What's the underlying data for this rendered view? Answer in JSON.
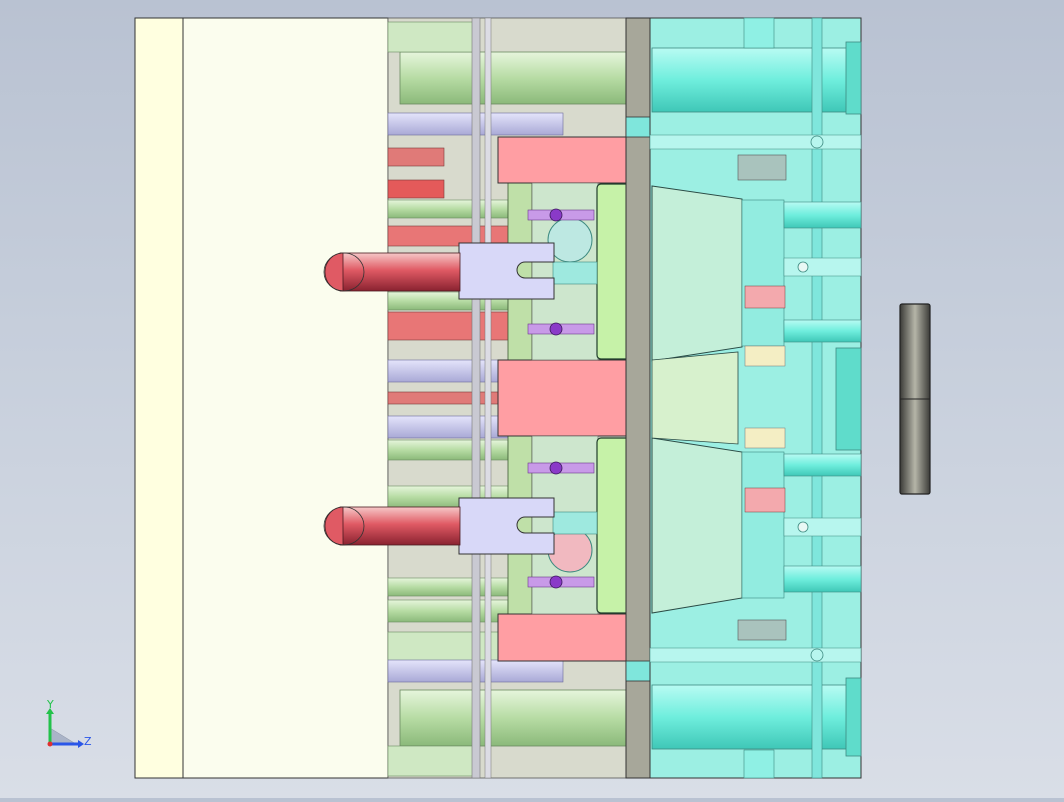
{
  "view": {
    "background_top": "#b9c2d2",
    "background_bottom": "#d9dee7"
  },
  "palette": {
    "plate_cream": "#ffffe0",
    "plate_pale": "#fbfdee",
    "pink": "#ff9ea3",
    "cyan": "#6ff0e0",
    "green": "#b8eaa8",
    "lavender": "#d8d8f8",
    "purple": "#b070d8",
    "gray": "#a7a79a"
  },
  "triad": {
    "y_label": "Y",
    "z_label": "Z",
    "y_color": "#22c24a",
    "z_color": "#2a56e8",
    "x_color": "#e03030"
  }
}
